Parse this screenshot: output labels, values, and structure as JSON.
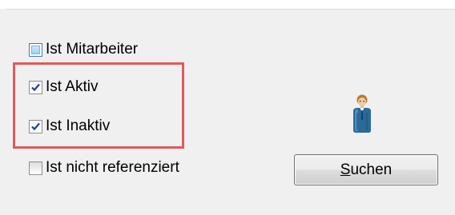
{
  "filters": {
    "options": [
      {
        "label": "Ist Mitarbeiter",
        "checked": false
      },
      {
        "label": "Ist Aktiv",
        "checked": true
      },
      {
        "label": "Ist Inaktiv",
        "checked": true
      },
      {
        "label": "Ist nicht referenziert",
        "checked": false
      }
    ]
  },
  "search_button": {
    "mnemonic": "S",
    "label_rest": "uchen"
  },
  "icons": {
    "person": "person-icon"
  },
  "colors": {
    "highlight": "#e05a5a",
    "checkmark": "#1f3f8f",
    "background": "#f0f0f0"
  }
}
